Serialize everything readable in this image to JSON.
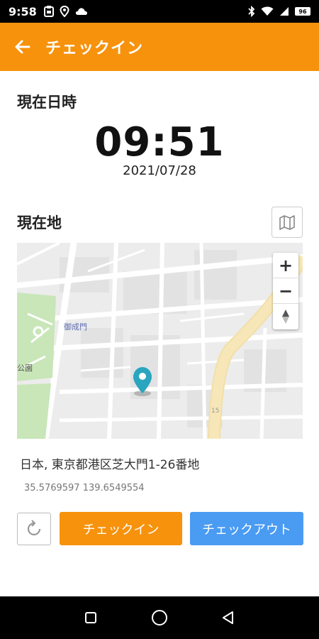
{
  "status_bar": {
    "time": "9:58",
    "battery_level": "96"
  },
  "app_bar": {
    "title": "チェックイン"
  },
  "datetime_section": {
    "title": "現在日時",
    "time": "09:51",
    "date": "2021/07/28"
  },
  "location_section": {
    "title": "現在地",
    "map": {
      "labels": {
        "gate": "御成門",
        "park": "公園",
        "road_number": "15"
      },
      "zoom_in": "+",
      "zoom_out": "−"
    },
    "address": "日本, 東京都港区芝大門1-26番地",
    "coordinates": "35.5769597 139.6549554"
  },
  "actions": {
    "checkin_label": "チェックイン",
    "checkout_label": "チェックアウト"
  },
  "colors": {
    "accent": "#F7920D",
    "checkout": "#4A9BF2",
    "marker": "#2AA5BF"
  }
}
